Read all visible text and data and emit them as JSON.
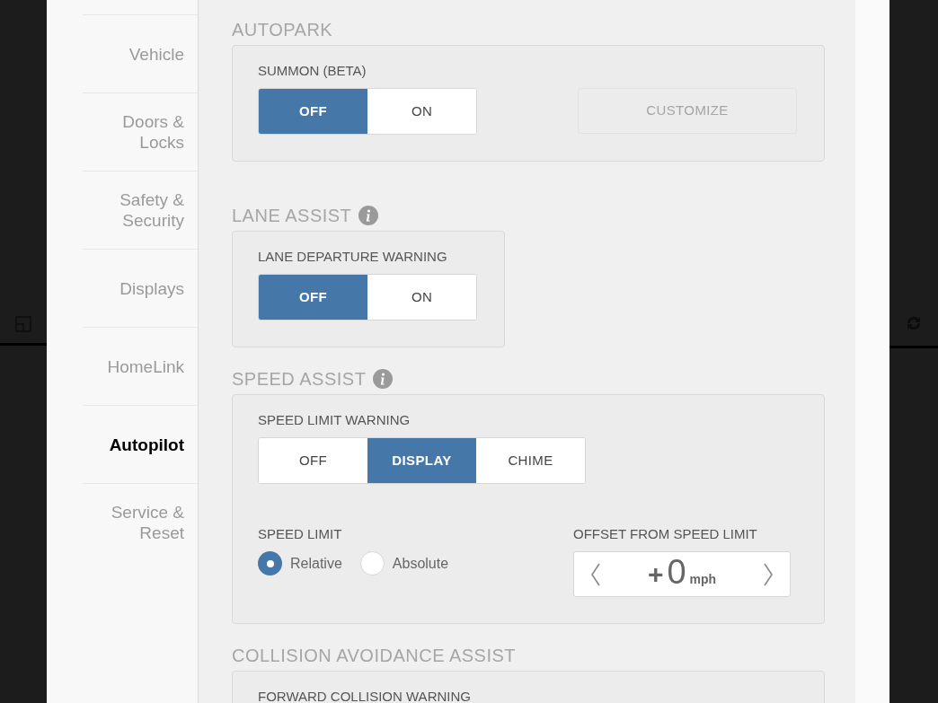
{
  "sidebar": {
    "items": [
      {
        "label": "Vehicle",
        "selected": false
      },
      {
        "label": "Doors & Locks",
        "selected": false
      },
      {
        "label": "Safety & Security",
        "selected": false
      },
      {
        "label": "Displays",
        "selected": false
      },
      {
        "label": "HomeLink",
        "selected": false
      },
      {
        "label": "Autopilot",
        "selected": true
      },
      {
        "label": "Service & Reset",
        "selected": false
      }
    ]
  },
  "sections": [
    {
      "title": "AUTOPARK",
      "info": false,
      "rows": [
        [
          {
            "kind": "segmented",
            "label": "SUMMON (BETA)",
            "options": [
              {
                "label": "OFF",
                "selected": true
              },
              {
                "label": "ON",
                "selected": false
              }
            ]
          },
          {
            "kind": "button",
            "label": "CUSTOMIZE",
            "disabled": true
          }
        ]
      ]
    },
    {
      "title": "LANE ASSIST",
      "info": true,
      "rows": [
        [
          {
            "kind": "segmented",
            "label": "LANE DEPARTURE WARNING",
            "options": [
              {
                "label": "OFF",
                "selected": true
              },
              {
                "label": "ON",
                "selected": false
              }
            ]
          }
        ]
      ]
    },
    {
      "title": "SPEED ASSIST",
      "info": true,
      "rows": [
        [
          {
            "kind": "segmented",
            "label": "SPEED LIMIT WARNING",
            "options": [
              {
                "label": "OFF",
                "selected": false
              },
              {
                "label": "DISPLAY",
                "selected": true
              },
              {
                "label": "CHIME",
                "selected": false
              }
            ]
          }
        ],
        [
          {
            "kind": "radio",
            "label": "SPEED LIMIT",
            "options": [
              {
                "label": "Relative",
                "selected": true
              },
              {
                "label": "Absolute",
                "selected": false
              }
            ]
          },
          {
            "kind": "stepper",
            "label": "OFFSET FROM SPEED LIMIT",
            "sign": "+",
            "value": "0",
            "unit": "mph"
          }
        ]
      ]
    },
    {
      "title": "COLLISION AVOIDANCE ASSIST",
      "info": false,
      "rows": [
        [
          {
            "kind": "label",
            "label": "FORWARD COLLISION WARNING"
          }
        ]
      ]
    }
  ]
}
